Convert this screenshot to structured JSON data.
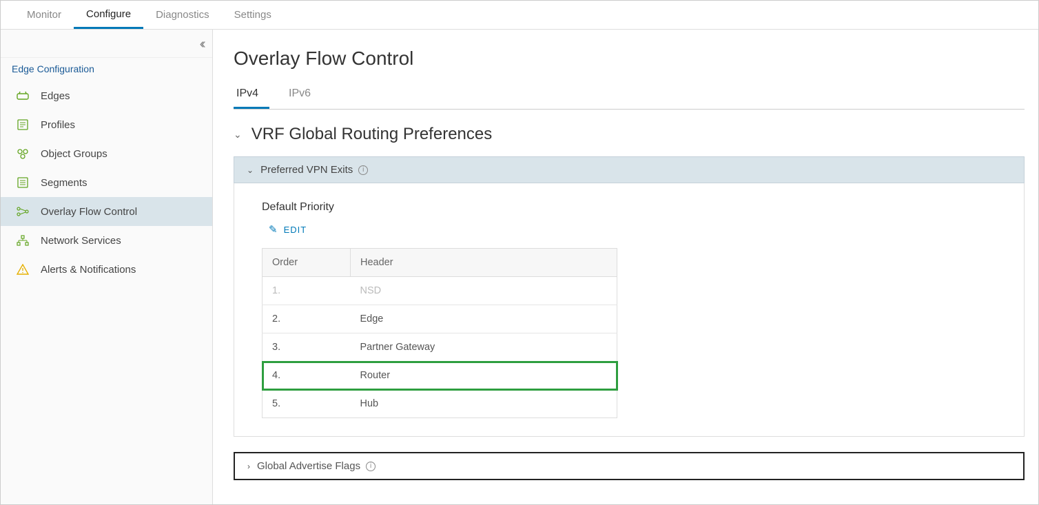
{
  "topTabs": {
    "monitor": "Monitor",
    "configure": "Configure",
    "diagnostics": "Diagnostics",
    "settings": "Settings",
    "active": "configure"
  },
  "sidebar": {
    "sectionTitle": "Edge Configuration",
    "items": [
      {
        "label": "Edges",
        "icon": "edges-icon"
      },
      {
        "label": "Profiles",
        "icon": "profiles-icon"
      },
      {
        "label": "Object Groups",
        "icon": "object-groups-icon"
      },
      {
        "label": "Segments",
        "icon": "segments-icon"
      },
      {
        "label": "Overlay Flow Control",
        "icon": "overlay-icon"
      },
      {
        "label": "Network Services",
        "icon": "network-icon"
      },
      {
        "label": "Alerts & Notifications",
        "icon": "alerts-icon"
      }
    ],
    "activeIndex": 4
  },
  "page": {
    "title": "Overlay Flow Control",
    "subTabs": {
      "ipv4": "IPv4",
      "ipv6": "IPv6",
      "active": "ipv4"
    },
    "sectionTitle": "VRF Global Routing Preferences",
    "vpnExits": {
      "label": "Preferred VPN Exits",
      "defaultPriorityTitle": "Default Priority",
      "editLabel": "EDIT",
      "columns": {
        "order": "Order",
        "header": "Header"
      },
      "rows": [
        {
          "order": "1.",
          "header": "NSD",
          "disabled": true
        },
        {
          "order": "2.",
          "header": "Edge"
        },
        {
          "order": "3.",
          "header": "Partner Gateway"
        },
        {
          "order": "4.",
          "header": "Router",
          "highlight": true
        },
        {
          "order": "5.",
          "header": "Hub"
        }
      ]
    },
    "gaf": {
      "label": "Global Advertise Flags"
    }
  }
}
